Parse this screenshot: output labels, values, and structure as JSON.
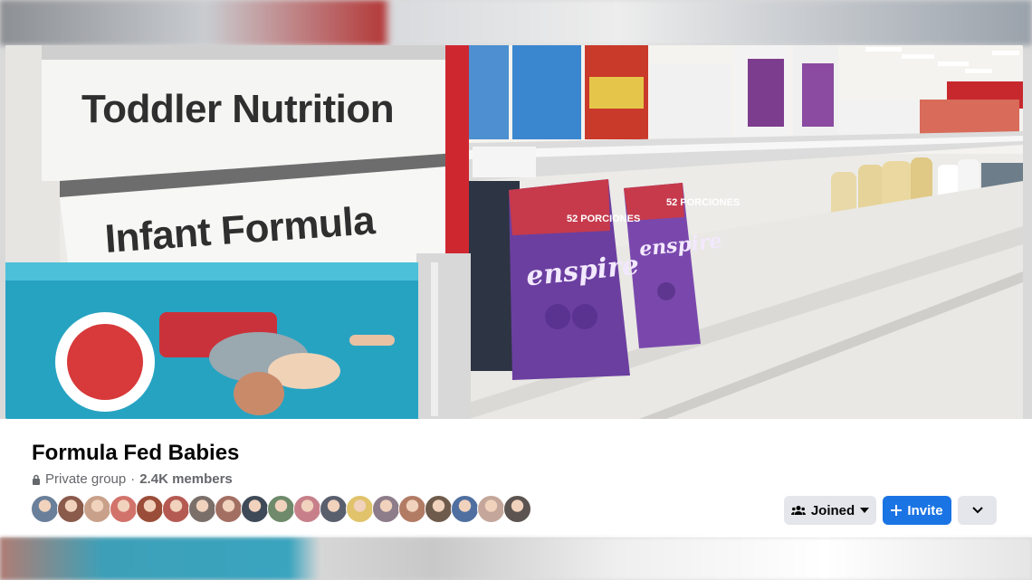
{
  "cover": {
    "sign_top": "Toddler Nutrition",
    "sign_bottom": "Infant Formula",
    "box_badge": "52 PORCIONES",
    "box_brand": "enspire"
  },
  "group": {
    "name": "Formula Fed Babies",
    "privacy": "Private group",
    "separator": "·",
    "members": "2.4K members",
    "privacy_icon": "lock-icon"
  },
  "avatars": [
    {
      "color": "#6a7f9a"
    },
    {
      "color": "#8a5a4a"
    },
    {
      "color": "#c9a18b"
    },
    {
      "color": "#d2736b"
    },
    {
      "color": "#9a4d38"
    },
    {
      "color": "#b55a52"
    },
    {
      "color": "#7b6f6a"
    },
    {
      "color": "#a36f63"
    },
    {
      "color": "#3f4a58"
    },
    {
      "color": "#6e8a6a"
    },
    {
      "color": "#c7808a"
    },
    {
      "color": "#5a5f6e"
    },
    {
      "color": "#e0c36a"
    },
    {
      "color": "#8d7c8a"
    },
    {
      "color": "#b27b64"
    },
    {
      "color": "#6f5b4c"
    },
    {
      "color": "#4f6fa0"
    },
    {
      "color": "#c4a79a"
    },
    {
      "color": "#5c5450"
    }
  ],
  "actions": {
    "joined_label": "Joined",
    "joined_icon": "people-icon",
    "joined_caret": "caret-down-icon",
    "invite_label": "Invite",
    "invite_icon": "plus-icon",
    "more_icon": "chevron-down-icon",
    "accent": "#1b74e4"
  }
}
